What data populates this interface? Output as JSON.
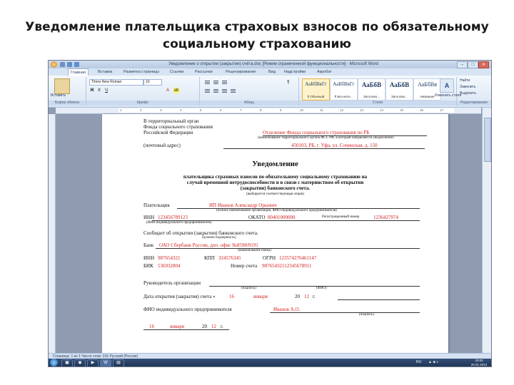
{
  "slide": {
    "title_line1": "Уведомление плательщика страховых взносов по обязательному",
    "title_line2": "социальному страхованию"
  },
  "window": {
    "title": "Уведомление о открытии (закрытии) счёта.doc [Режим ограниченной функциональности] - Microsoft Word",
    "minimize": "–",
    "maximize": "□",
    "close": "✕"
  },
  "ribbon_tabs": [
    "Главная",
    "Вставка",
    "Разметка страницы",
    "Ссылки",
    "Рассылки",
    "Рецензирование",
    "Вид",
    "Надстройки",
    "Акробат"
  ],
  "ribbon": {
    "paste_label": "Вставить",
    "clipboard_label": "Буфер обмена",
    "font_name": "Times New Roman",
    "font_size": "10",
    "bold": "Ж",
    "italic": "К",
    "underline": "Ч",
    "font_label": "Шрифт",
    "paragraph_label": "Абзац",
    "styles_label": "Стили",
    "styles": [
      {
        "preview": "АаБбВвГг",
        "name": "¶ Обычный"
      },
      {
        "preview": "АаБбВвГг",
        "name": "¶ Без инте..."
      },
      {
        "preview": "АаБбВ",
        "name": "Заголово..."
      },
      {
        "preview": "АаБбВ",
        "name": "Заголово..."
      },
      {
        "preview": "АаБбВв",
        "name": "Название"
      }
    ],
    "change_styles": "Изменить стили",
    "find": "Найти",
    "replace": "Заменить",
    "select": "Выделить",
    "editing_label": "Редактирование"
  },
  "ruler_ticks": [
    "1",
    "2",
    "3",
    "4",
    "5",
    "6",
    "7",
    "8",
    "9",
    "10",
    "11",
    "12",
    "13",
    "14",
    "15",
    "16",
    "17"
  ],
  "document": {
    "addr_line1": "В территориальный орган",
    "addr_line2": "Фонда социального страхования",
    "addr_line3": "Российской Федерации",
    "addr_value": "Отделение Фонда социального страхования по РБ",
    "addr_caption": "(наименование территориального органа ФСС РФ, в который направляется уведомление)",
    "postal_label": "(почтовый адрес)",
    "postal_value": "450103, РБ, г. Уфа, ул. Сочинская, д. 150",
    "title": "Уведомление",
    "heading1": "плательщика страховых взносов по обязательному социальному страхованию на",
    "heading2": "случай временной нетрудоспособности и в связи с материнством об открытии",
    "heading3": "(закрытии) банковского счета.",
    "heading_caption": "(выбирается соответствующая опция)",
    "payer_label": "Плательщик",
    "payer_value": "ИП Иванов Александр Орьевич",
    "payer_caption": "(полное наименование организации, ФИО индивидуального предпринимателя)",
    "inn_label": "ИНН",
    "inn_value": "123456789123",
    "okato_label": "ОКАТО",
    "okato_value": "80401000000",
    "regnum_label": "Регистрационный номер",
    "regnum_value": "1236427074",
    "payer_caption2": "(ИНН индивидуального предпринимателя)",
    "msg_label": "Сообщает об открытии (закрытии) банковского счета.",
    "msg_caption": "(нужное подчеркнуть)",
    "bank_label": "Банк",
    "bank_value": "ОАО Сбербанк России, доп. офис №8598/0191",
    "bank_caption": "(наименование банка)",
    "bank_inn_label": "ИНН",
    "bank_inn_value": "987654321",
    "kpp_label": "КПП",
    "kpp_value": "324576345",
    "ogrn_label": "ОГРН",
    "ogrn_value": "123574276461147",
    "bik_label": "БИК",
    "bik_value": "536932804",
    "account_label": "Номер счета",
    "account_value": "98765432112345678911",
    "head_label": "Руководитель организации",
    "head_caption1": "(подпись)",
    "head_caption2": "(ФИО)",
    "date_label": "Дата открытия (закрытия) счета «",
    "date_day": "16",
    "date_month": "января",
    "date_year_prefix": "20",
    "date_year": "12",
    "date_suffix": "г.",
    "fio_label": "ФИО индивидуального предпринимателя",
    "fio_value": "Иванов А.О.",
    "fio_caption": "(подпись)",
    "sign_day": "16",
    "sign_month": "января",
    "sign_year_prefix": "20",
    "sign_year": "12",
    "sign_suffix": "г."
  },
  "status_bar": "Страница: 1 из 1 Число слов: 216 Русский (Россия)",
  "taskbar": {
    "lang": "RU",
    "time": "23:02",
    "date": "20.01.2013"
  }
}
